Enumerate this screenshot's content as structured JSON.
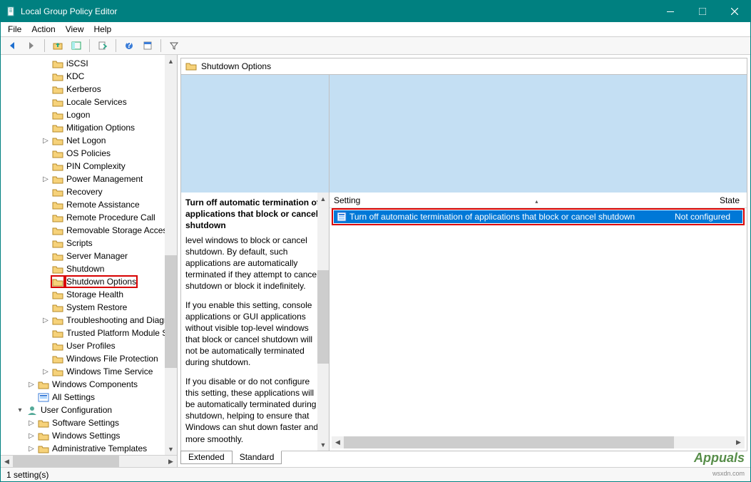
{
  "window": {
    "title": "Local Group Policy Editor"
  },
  "menu": {
    "file": "File",
    "action": "Action",
    "view": "View",
    "help": "Help"
  },
  "tree": {
    "items": [
      {
        "label": "iSCSI",
        "indent": 3
      },
      {
        "label": "KDC",
        "indent": 3
      },
      {
        "label": "Kerberos",
        "indent": 3
      },
      {
        "label": "Locale Services",
        "indent": 3
      },
      {
        "label": "Logon",
        "indent": 3
      },
      {
        "label": "Mitigation Options",
        "indent": 3
      },
      {
        "label": "Net Logon",
        "indent": 3,
        "chev": ">"
      },
      {
        "label": "OS Policies",
        "indent": 3
      },
      {
        "label": "PIN Complexity",
        "indent": 3
      },
      {
        "label": "Power Management",
        "indent": 3,
        "chev": ">"
      },
      {
        "label": "Recovery",
        "indent": 3
      },
      {
        "label": "Remote Assistance",
        "indent": 3
      },
      {
        "label": "Remote Procedure Call",
        "indent": 3
      },
      {
        "label": "Removable Storage Access",
        "indent": 3
      },
      {
        "label": "Scripts",
        "indent": 3
      },
      {
        "label": "Server Manager",
        "indent": 3
      },
      {
        "label": "Shutdown",
        "indent": 3
      },
      {
        "label": "Shutdown Options",
        "indent": 3,
        "highlighted": true
      },
      {
        "label": "Storage Health",
        "indent": 3
      },
      {
        "label": "System Restore",
        "indent": 3
      },
      {
        "label": "Troubleshooting and Diagnostics",
        "indent": 3,
        "chev": ">"
      },
      {
        "label": "Trusted Platform Module Services",
        "indent": 3
      },
      {
        "label": "User Profiles",
        "indent": 3
      },
      {
        "label": "Windows File Protection",
        "indent": 3
      },
      {
        "label": "Windows Time Service",
        "indent": 3,
        "chev": ">"
      },
      {
        "label": "Windows Components",
        "indent": 2,
        "chev": ">"
      },
      {
        "label": "All Settings",
        "indent": 2,
        "icon": "settings"
      },
      {
        "label": "User Configuration",
        "indent": 1,
        "chev": "v",
        "icon": "user"
      },
      {
        "label": "Software Settings",
        "indent": 2,
        "chev": ">"
      },
      {
        "label": "Windows Settings",
        "indent": 2,
        "chev": ">"
      },
      {
        "label": "Administrative Templates",
        "indent": 2,
        "chev": ">"
      }
    ]
  },
  "header": {
    "title": "Shutdown Options"
  },
  "description": {
    "heading": "Turn off automatic termination of applications that block or cancel shutdown",
    "para1": "level windows to block or cancel shutdown. By default, such applications are automatically terminated if they attempt to cancel shutdown or block it indefinitely.",
    "para2": "If you enable this setting, console applications or GUI applications without visible top-level windows that block or cancel shutdown will not be automatically terminated during shutdown.",
    "para3": "If you disable or do not configure this setting, these applications will be automatically terminated during shutdown, helping to ensure that Windows can shut down faster and more smoothly."
  },
  "columns": {
    "setting": "Setting",
    "state": "State"
  },
  "setting_item": {
    "name": "Turn off automatic termination of applications that block or cancel shutdown",
    "state": "Not configured"
  },
  "tabs": {
    "extended": "Extended",
    "standard": "Standard"
  },
  "status": "1 setting(s)",
  "branding": {
    "name": "Appuals",
    "sub": "wsxdn.com"
  }
}
